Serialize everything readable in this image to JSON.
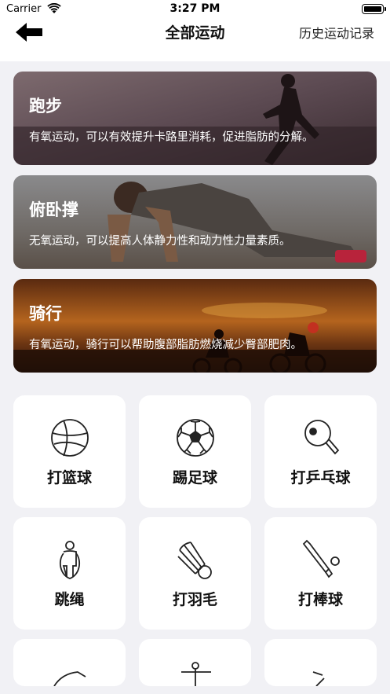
{
  "status_bar": {
    "carrier": "Carrier",
    "time": "3:27 PM"
  },
  "nav": {
    "title": "全部运动",
    "history": "历史运动记录"
  },
  "banners": [
    {
      "title": "跑步",
      "desc": "有氧运动，可以有效提升卡路里消耗，促进脂肪的分解。"
    },
    {
      "title": "俯卧撑",
      "desc": "无氧运动，可以提高人体静力性和动力性力量素质。"
    },
    {
      "title": "骑行",
      "desc": "有氧运动，骑行可以帮助腹部脂肪燃烧减少臀部肥肉。"
    }
  ],
  "sports": [
    {
      "label": "打篮球",
      "icon": "basketball-icon"
    },
    {
      "label": "踢足球",
      "icon": "soccer-ball-icon"
    },
    {
      "label": "打乒乓球",
      "icon": "ping-pong-paddle-icon"
    },
    {
      "label": "跳绳",
      "icon": "jump-rope-icon"
    },
    {
      "label": "打羽毛",
      "icon": "shuttlecock-icon"
    },
    {
      "label": "打棒球",
      "icon": "baseball-bat-icon"
    }
  ],
  "colors": {
    "background": "#f1f1f5",
    "card": "#ffffff",
    "text": "#111111"
  }
}
